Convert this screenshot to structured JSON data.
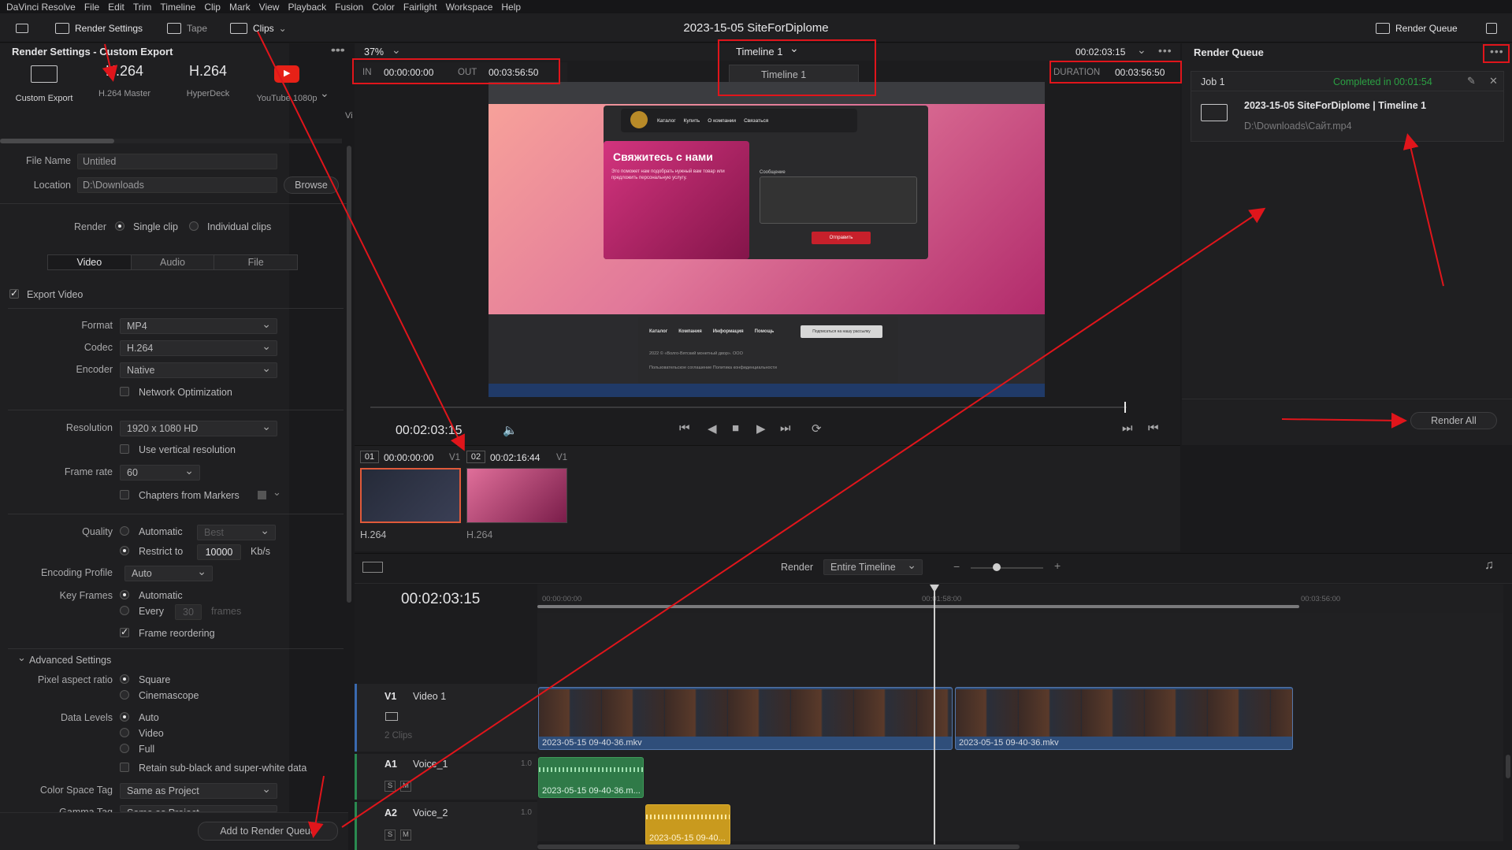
{
  "menubar": [
    "DaVinci Resolve",
    "File",
    "Edit",
    "Trim",
    "Timeline",
    "Clip",
    "Mark",
    "View",
    "Playback",
    "Fusion",
    "Color",
    "Fairlight",
    "Workspace",
    "Help"
  ],
  "toolbar": {
    "render_settings": "Render Settings",
    "tape": "Tape",
    "clips": "Clips",
    "project_title": "2023-15-05 SiteForDiplome",
    "render_queue": "Render Queue"
  },
  "render_settings": {
    "header": "Render Settings - Custom Export",
    "presets": [
      {
        "big": "",
        "small": "Custom Export"
      },
      {
        "big": "H.264",
        "small": "H.264 Master"
      },
      {
        "big": "H.264",
        "small": "HyperDeck"
      },
      {
        "big": "",
        "small": "YouTube 1080p"
      },
      {
        "big": "",
        "small": "Vi"
      }
    ],
    "file_name_label": "File Name",
    "file_name": "Untitled",
    "location_label": "Location",
    "location": "D:\\Downloads",
    "browse": "Browse",
    "render_label": "Render",
    "single_clip": "Single clip",
    "individual_clips": "Individual clips",
    "tabs": [
      "Video",
      "Audio",
      "File"
    ],
    "export_video": "Export Video",
    "format_label": "Format",
    "format": "MP4",
    "codec_label": "Codec",
    "codec": "H.264",
    "encoder_label": "Encoder",
    "encoder": "Native",
    "network_opt": "Network Optimization",
    "resolution_label": "Resolution",
    "resolution": "1920 x 1080 HD",
    "vertical_res": "Use vertical resolution",
    "frame_rate_label": "Frame rate",
    "frame_rate": "60",
    "chapters": "Chapters from Markers",
    "quality_label": "Quality",
    "automatic": "Automatic",
    "best": "Best",
    "restrict_to": "Restrict to",
    "bitrate": "10000",
    "kbs": "Kb/s",
    "encoding_profile_label": "Encoding Profile",
    "encoding_profile": "Auto",
    "key_frames_label": "Key Frames",
    "kf_automatic": "Automatic",
    "kf_every": "Every",
    "kf_value": "30",
    "kf_frames": "frames",
    "frame_reordering": "Frame reordering",
    "advanced": "Advanced Settings",
    "pixel_aspect_label": "Pixel aspect ratio",
    "square": "Square",
    "cinemascope": "Cinemascope",
    "data_levels_label": "Data Levels",
    "dl_auto": "Auto",
    "dl_video": "Video",
    "dl_full": "Full",
    "retain": "Retain sub-black and super-white data",
    "color_space_label": "Color Space Tag",
    "color_space": "Same as Project",
    "gamma_label": "Gamma Tag",
    "gamma": "Same as Project",
    "add_to_queue": "Add to Render Queue"
  },
  "viewer": {
    "zoom": "37%",
    "timeline_name": "Timeline 1",
    "timeline_option": "Timeline 1",
    "timecode_top": "00:02:03:15",
    "in_label": "IN",
    "in_tc": "00:00:00:00",
    "out_label": "OUT",
    "out_tc": "00:03:56:50",
    "duration_label": "DURATION",
    "duration_tc": "00:03:56:50",
    "current_tc": "00:02:03:15",
    "site_heading": "Свяжитесь с нами",
    "site_text": "Это поможет нам подобрать нужный вам товар или предложить персональную услугу.",
    "site_nav": [
      "Каталог",
      "Купить",
      "О компании",
      "Связаться"
    ],
    "site_send": "Отправить",
    "site_message": "Сообщение",
    "footer_links": [
      "Каталог",
      "Компания",
      "Информация",
      "Помощь"
    ],
    "footer_subscribe": "Подписаться на нашу рассылку",
    "footer_copy": "2022 © «Волго-Вятский монетный двор». ООО",
    "footer_policy": "Пользовательское соглашение   Политика конфиденциальности"
  },
  "clips": [
    {
      "num": "01",
      "tc": "00:00:00:00",
      "track": "V1",
      "codec": "H.264"
    },
    {
      "num": "02",
      "tc": "00:02:16:44",
      "track": "V1",
      "codec": "H.264"
    }
  ],
  "render_queue": {
    "header": "Render Queue",
    "job_title": "Job 1",
    "job_status": "Completed in 00:01:54",
    "job_name": "2023-15-05 SiteForDiplome | Timeline 1",
    "job_path": "D:\\Downloads\\Сайт.mp4",
    "render_all": "Render All"
  },
  "timeline": {
    "render_label": "Render",
    "render_range": "Entire Timeline",
    "timecode": "00:02:03:15",
    "ruler": [
      "00:00:00:00",
      "00:01:58:00",
      "00:03:56:00"
    ],
    "tracks": [
      {
        "id": "V1",
        "name": "Video 1",
        "clips_count": "2 Clips"
      },
      {
        "id": "A1",
        "name": "Voice_1",
        "level": "1.0"
      },
      {
        "id": "A2",
        "name": "Voice_2",
        "level": "1.0"
      }
    ],
    "video_clip": "2023-05-15 09-40-36.mkv",
    "audio_clip_1": "2023-05-15 09-40-36.m...",
    "audio_clip_2": "2023-05-15 09-40...",
    "s_label": "S",
    "m_label": "M"
  }
}
